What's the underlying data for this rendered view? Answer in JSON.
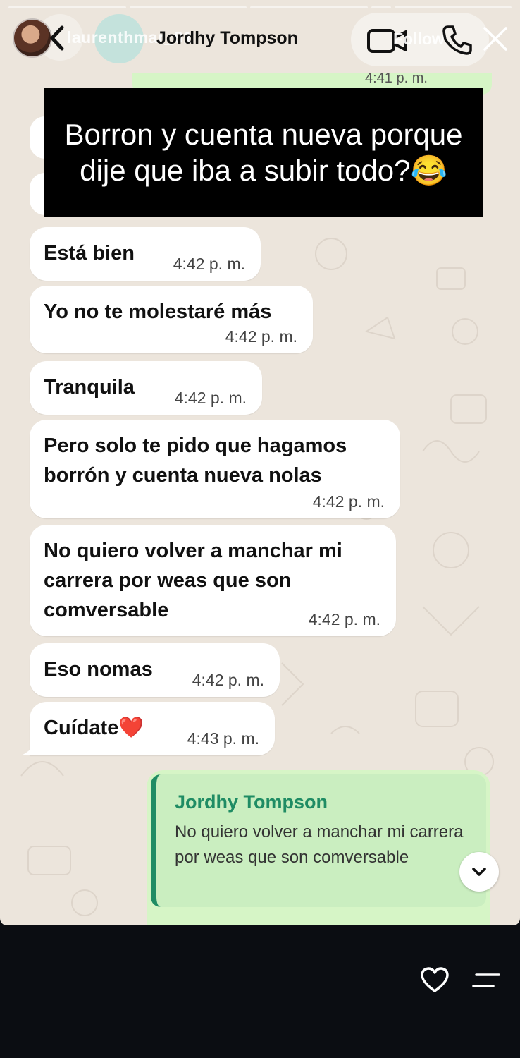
{
  "story": {
    "username": "laurenthmar_81",
    "follow_label": "Follow",
    "caption": "Borron y cuenta nueva porque dije que iba a subir todo?😂"
  },
  "chat": {
    "contact_name": "Jordhy Tompson",
    "top_partial_time": "4:41 p. m.",
    "messages": [
      {
        "text": "Está bien",
        "time": "4:42 p. m."
      },
      {
        "text": "Yo no te molestaré más",
        "time": "4:42 p. m."
      },
      {
        "text": "Tranquila",
        "time": "4:42 p. m."
      },
      {
        "text": "Pero solo te pido que hagamos\nborrón y cuenta nueva nolas",
        "time": "4:42 p. m."
      },
      {
        "text": "No quiero volver a manchar mi\ncarrera por weas que son\ncomversable",
        "time": "4:42 p. m."
      },
      {
        "text": "Eso nomas",
        "time": "4:42 p. m."
      },
      {
        "text": "Cuídate❤️",
        "time": "4:43 p. m."
      }
    ],
    "reply": {
      "quoted_name": "Jordhy Tompson",
      "quoted_text": "No quiero volver a manchar mi carrera por weas que son comversable"
    }
  },
  "icons": {
    "back": "chevron-left-icon",
    "video": "video-camera-icon",
    "phone": "phone-icon",
    "close": "close-icon",
    "scroll": "chevron-down-icon",
    "like": "heart-icon",
    "menu": "menu-icon"
  },
  "colors": {
    "chat_background": "#ece5dc",
    "outgoing_bubble": "#d6f5c6",
    "quote_accent": "#1f8c64",
    "caption_background": "#000000",
    "story_footer": "#0b0d12"
  }
}
